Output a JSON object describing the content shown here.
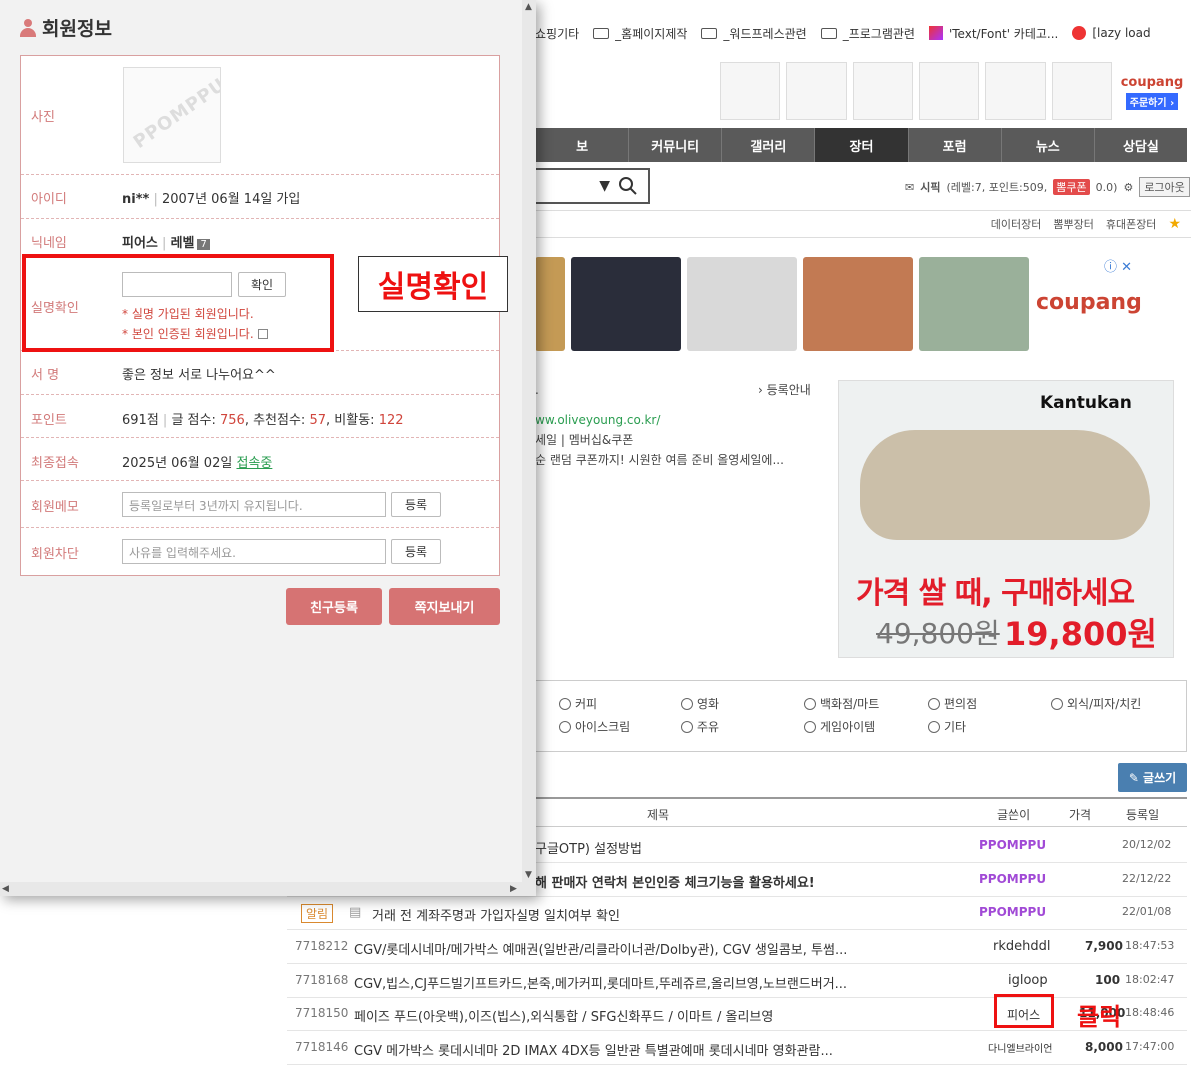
{
  "bookmarks": [
    "쇼핑기타",
    "_홈페이지제작",
    "_워드프레스관련",
    "_프로그램관련",
    "'Text/Font' 카테고...",
    "[lazy load"
  ],
  "ad_top": {
    "brand": "coupang",
    "cta": "주문하기 ›"
  },
  "nav": [
    "보",
    "커뮤니티",
    "갤러리",
    "장터",
    "포럼",
    "뉴스",
    "상담실"
  ],
  "nav_active": 3,
  "userline": {
    "name": "시픽",
    "detail": "(레벨:7, 포인트:509,",
    "coupon": "뽐쿠폰",
    "coupon_val": "0.0)",
    "logout": "로그아웃"
  },
  "sublinks": [
    "데이터장터",
    "뽐뿌장터",
    "휴대폰장터"
  ],
  "coupang_logo": "coupang",
  "info_lines": {
    "line1": ".",
    "url": "ww.oliveyoung.co.kr/",
    "line3": "세일 | 멤버십&쿠폰",
    "line4": "순 랜덤 쿠폰까지! 시원한 여름 준비 올영세일에..."
  },
  "reg_info": "등록안내",
  "shoe_ad": {
    "brand": "Kantukan",
    "headline": "가격 쌀 때, 구매하세요",
    "old_price": "49,800원",
    "new_price": "19,800원"
  },
  "categories": [
    "커피",
    "영화",
    "백화점/마트",
    "편의점",
    "외식/피자/치킨",
    "아이스크림",
    "주유",
    "게임아이템",
    "기타"
  ],
  "write_button": "글쓰기",
  "table_headers": {
    "title": "제목",
    "writer": "글쓴이",
    "price": "가격",
    "date": "등록일"
  },
  "rows": [
    {
      "num": "",
      "title": "구글OTP) 설정방법",
      "writer": "PPOMPPU",
      "price": "",
      "date": "20/12/02"
    },
    {
      "num": "",
      "title": "해 판매자 연락처 본인인증 체크기능을 활용하세요!",
      "writer": "PPOMPPU",
      "price": "",
      "date": "22/12/22"
    },
    {
      "num": "알림",
      "title": "거래 전 계좌주명과 가입자실명 일치여부 확인",
      "writer": "PPOMPPU",
      "price": "",
      "date": "22/01/08"
    },
    {
      "num": "7718212",
      "title": "CGV/롯데시네마/메가박스 예매권(일반관/리클라이너관/Dolby관), CGV 생일콤보, 투썸...",
      "writer": "rkdehddl",
      "price": "7,900",
      "date": "18:47:53"
    },
    {
      "num": "7718168",
      "title": "CGV,빕스,CJ푸드빌기프트카드,본죽,메가커피,롯데마트,뚜레쥬르,올리브영,노브랜드버거...",
      "writer": "igloop",
      "price": "100",
      "date": "18:02:47"
    },
    {
      "num": "7718150",
      "title": "페이즈 푸드(아웃백),이즈(빕스),외식통합 / SFG신화푸드 / 이마트 / 올리브영",
      "writer": "피어스",
      "price": "11,000",
      "date": "18:48:46"
    },
    {
      "num": "7718146",
      "title": "CGV 메가박스 롯데시네마 2D IMAX 4DX등 일반관 특별관예매 롯데시네마 영화관람...",
      "writer": "다니엘브라이언",
      "price": "8,000",
      "date": "17:47:00"
    }
  ],
  "click_annotation": "클릭",
  "popup": {
    "title": "회원정보",
    "photo_label": "사진",
    "photo_watermark": "PPOMPPU",
    "id_label": "아이디",
    "id_value": "ni**",
    "join_date": "2007년 06월 14일 가입",
    "nick_label": "닉네임",
    "nick_value": "피어스",
    "level_label": "레벨",
    "level_value": "7",
    "realname_label": "실명확인",
    "confirm_button": "확인",
    "realname_msg1": "* 실명 가입된 회원입니다.",
    "realname_msg2": "* 본인 인증된 회원입니다.",
    "sign_label": "서 명",
    "sign_value": "좋은 정보 서로 나누어요^^",
    "point_label": "포인트",
    "points": "691점",
    "post_score_label": "글 점수:",
    "post_score": "756",
    "rec_label": ", 추천점수:",
    "rec_score": "57",
    "noact_label": ", 비활동:",
    "noact": "122",
    "last_label": "최종접속",
    "last_value": "2025년 06월 02일",
    "online": "접속중",
    "memo_label": "회원메모",
    "memo_placeholder": "등록일로부터 3년까지 유지됩니다.",
    "memo_button": "등록",
    "block_label": "회원차단",
    "block_placeholder": "사유를 입력해주세요.",
    "block_button": "등록",
    "friend_button": "친구등록",
    "message_button": "쪽지보내기",
    "annotation": "실명확인"
  }
}
